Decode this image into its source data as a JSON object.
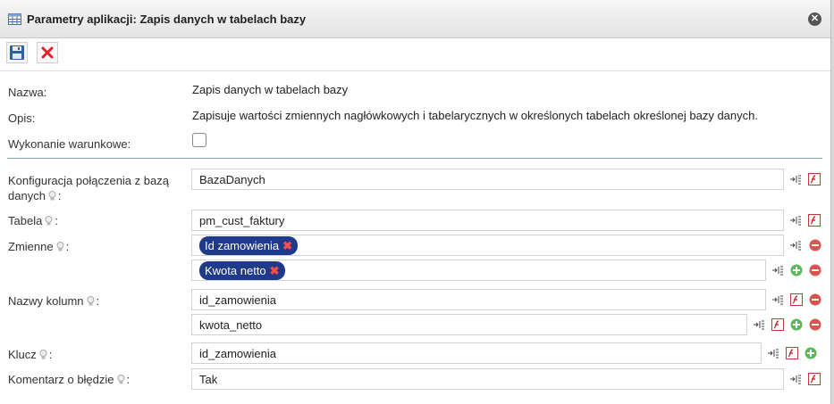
{
  "window": {
    "title": "Parametry aplikacji: Zapis danych w tabelach bazy",
    "close_icon": "close-icon",
    "title_icon": "table-icon"
  },
  "toolbar": {
    "save_icon": "save-icon",
    "cancel_icon": "delete-icon"
  },
  "info": {
    "name_label": "Nazwa:",
    "name_value": "Zapis danych w tabelach bazy",
    "desc_label": "Opis:",
    "desc_value": "Zapisuje wartości zmiennych nagłówkowych i tabelarycznych w określonych tabelach określonej bazy danych.",
    "conditional_label": "Wykonanie warunkowe:",
    "conditional_checked": false
  },
  "fields": {
    "connection": {
      "label_line1": "Konfiguracja połączenia z bazą",
      "label_line2": "danych",
      "colon": ":",
      "value": "BazaDanych"
    },
    "table": {
      "label": "Tabela",
      "colon": ":",
      "value": "pm_cust_faktury"
    },
    "variables": {
      "label": "Zmienne",
      "colon": ":",
      "items": [
        "Id zamowienia",
        "Kwota netto"
      ],
      "remove_glyph": "✖"
    },
    "columns": {
      "label": "Nazwy kolumn",
      "colon": ":",
      "items": [
        "id_zamowienia",
        "kwota_netto"
      ]
    },
    "key": {
      "label": "Klucz",
      "colon": ":",
      "value": "id_zamowienia"
    },
    "error_comment": {
      "label": "Komentarz o błędzie",
      "colon": ":",
      "value": "Tak"
    }
  },
  "icons": [
    "bulb-icon",
    "insert-variable-icon",
    "function-icon",
    "remove-icon",
    "add-icon"
  ],
  "colors": {
    "tag_bg": "#1f3a8a",
    "separator": "#7a9cc0",
    "remove": "#d9534f",
    "add": "#5cb85c"
  }
}
